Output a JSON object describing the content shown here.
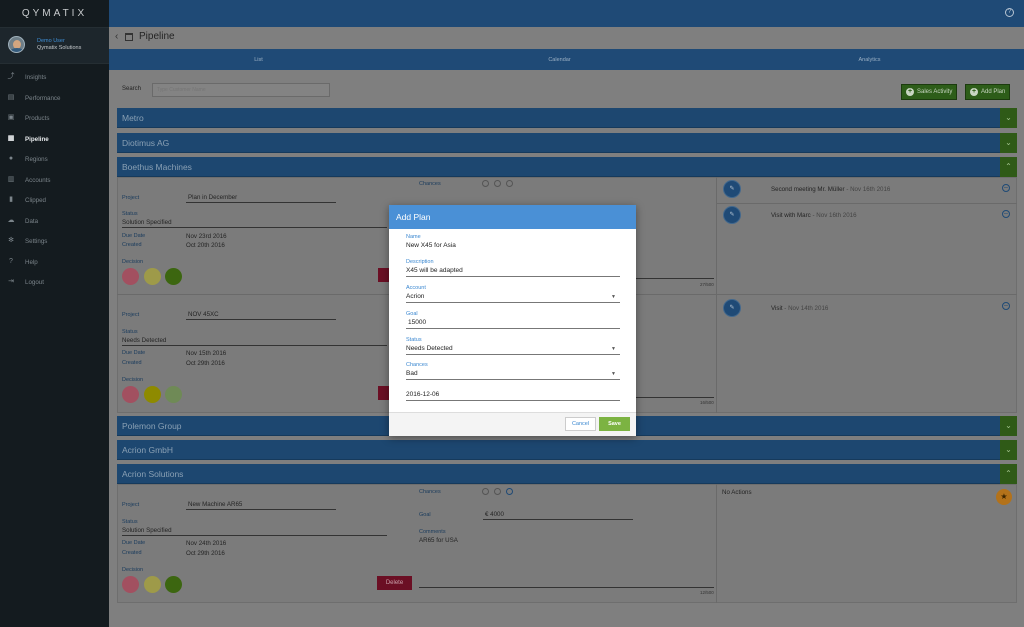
{
  "brand": "QYMATIX",
  "user": {
    "name": "Demo User",
    "company": "Qymatix Solutions"
  },
  "nav": [
    {
      "label": "Insights",
      "icon": "trend-icon"
    },
    {
      "label": "Performance",
      "icon": "chart-icon"
    },
    {
      "label": "Products",
      "icon": "box-icon"
    },
    {
      "label": "Pipeline",
      "icon": "calendar-icon",
      "active": true
    },
    {
      "label": "Regions",
      "icon": "pin-icon"
    },
    {
      "label": "Accounts",
      "icon": "building-icon"
    },
    {
      "label": "Clipped",
      "icon": "bookmark-icon"
    },
    {
      "label": "Data",
      "icon": "cloud-icon"
    },
    {
      "label": "Settings",
      "icon": "gear-icon"
    },
    {
      "label": "Help",
      "icon": "help-icon"
    },
    {
      "label": "Logout",
      "icon": "logout-icon"
    }
  ],
  "header": {
    "title": "Pipeline",
    "help": "?"
  },
  "tabs": [
    "List",
    "Calendar",
    "Analytics"
  ],
  "search": {
    "label": "Search",
    "placeholder": "Type Customer Name"
  },
  "buttons": {
    "sales_activity": "Sales Activity",
    "add_plan": "Add Plan"
  },
  "accounts": {
    "metro": "Metro",
    "diotimus": "Diotimus AG",
    "boethus": "Boethus Machines",
    "polemon": "Polemon Group",
    "acrion_gmbh": "Acrion GmbH",
    "acrion_solutions": "Acrion Solutions"
  },
  "labels": {
    "project": "Project",
    "status": "Status",
    "due_date": "Due Date",
    "created": "Created",
    "decision": "Decision",
    "chances": "Chances",
    "goal": "Goal",
    "comments": "Comments",
    "delete": "Delete"
  },
  "plans": [
    {
      "project": "Plan in December",
      "status": "Solution Specified",
      "due": "Nov 23rd 2016",
      "created": "Oct 20th 2016",
      "counter": "27/500"
    },
    {
      "project": "NOV 45XC",
      "status": "Needs Detected",
      "due": "Nov 15th 2016",
      "created": "Oct 29th 2016",
      "counter": "16/500"
    },
    {
      "project": "New Machine AR65",
      "status": "Solution Specified",
      "due": "Nov 24th 2016",
      "created": "Oct 29th 2016",
      "goal": "€ 4000",
      "comments": "AR65 for USA",
      "counter": "12/500",
      "no_actions": "No Actions"
    }
  ],
  "activities": [
    {
      "title": "Second meeting Mr. Müller",
      "date": " - Nov 16th 2016"
    },
    {
      "title": "Visit with Marc",
      "date": " - Nov 16th 2016"
    },
    {
      "title": "Visit",
      "date": " - Nov 14th 2016"
    }
  ],
  "modal": {
    "title": "Add Plan",
    "fields": [
      {
        "label": "Name",
        "value": "New X45 for Asia"
      },
      {
        "label": "Description",
        "value": "X45 will be adapted"
      },
      {
        "label": "Account",
        "value": "Acrion"
      },
      {
        "label": "Goal",
        "value": "15000"
      },
      {
        "label": "Status",
        "value": "Needs Detected"
      },
      {
        "label": "Chances",
        "value": "Bad"
      }
    ],
    "date": "2016-12-06",
    "cancel": "Cancel",
    "save": "Save"
  },
  "colors": {
    "accent": "#4a90d6",
    "save": "#7cb342",
    "header": "#1f4a76",
    "delete": "#6b0f24"
  }
}
